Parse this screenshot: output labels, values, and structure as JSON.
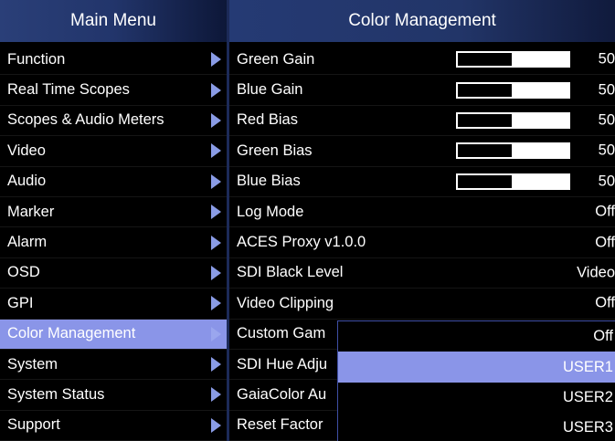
{
  "main_menu": {
    "title": "Main Menu",
    "items": [
      {
        "label": "Function"
      },
      {
        "label": "Real Time Scopes"
      },
      {
        "label": "Scopes & Audio Meters"
      },
      {
        "label": "Video"
      },
      {
        "label": "Audio"
      },
      {
        "label": "Marker"
      },
      {
        "label": "Alarm"
      },
      {
        "label": "OSD"
      },
      {
        "label": "GPI"
      },
      {
        "label": "Color Management",
        "selected": true
      },
      {
        "label": "System"
      },
      {
        "label": "System Status"
      },
      {
        "label": "Support"
      }
    ]
  },
  "color_management": {
    "title": "Color Management",
    "rows": [
      {
        "label": "Green Gain",
        "value": "50",
        "slider_fraction": 0.5
      },
      {
        "label": "Blue Gain",
        "value": "50",
        "slider_fraction": 0.5
      },
      {
        "label": "Red Bias",
        "value": "50",
        "slider_fraction": 0.5
      },
      {
        "label": "Green Bias",
        "value": "50",
        "slider_fraction": 0.5
      },
      {
        "label": "Blue Bias",
        "value": "50",
        "slider_fraction": 0.5
      },
      {
        "label": "Log Mode",
        "value": "Off"
      },
      {
        "label": "ACES Proxy v1.0.0",
        "value": "Off"
      },
      {
        "label": "SDI Black Level",
        "value": "Video"
      },
      {
        "label": "Video Clipping",
        "value": "Off"
      },
      {
        "label": "Custom Gam",
        "value": ""
      },
      {
        "label": "SDI Hue Adju",
        "value": ""
      },
      {
        "label": "GaiaColor Au",
        "value": ""
      },
      {
        "label": "Reset Factor",
        "value": ""
      }
    ]
  },
  "dropdown": {
    "options": [
      {
        "label": "Off"
      },
      {
        "label": "USER1",
        "highlighted": true
      },
      {
        "label": "USER2"
      },
      {
        "label": "USER3"
      }
    ]
  },
  "colors": {
    "header_bg": "#22356b",
    "selection_bg": "#8a95e8",
    "arrow": "#8a9ce6",
    "background": "#000000",
    "text": "#ffffff"
  }
}
